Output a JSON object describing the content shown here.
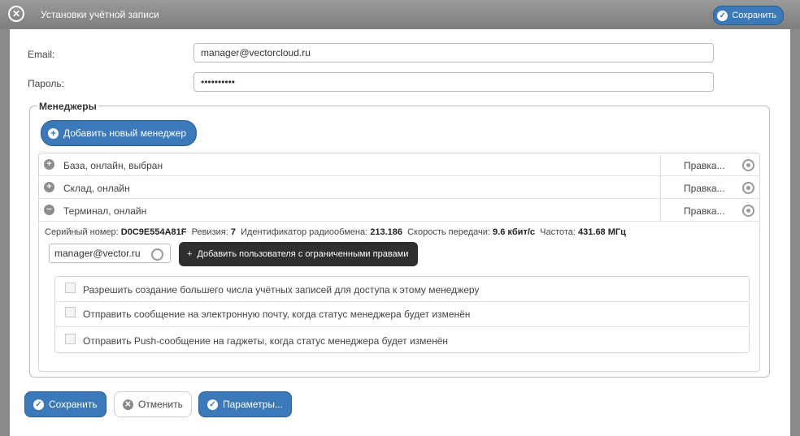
{
  "window": {
    "title": "Установки учётной записи",
    "save_label": "Сохранить"
  },
  "account": {
    "email_label": "Email:",
    "email_value": "manager@vectorcloud.ru",
    "password_label": "Пароль:",
    "password_value": "••••••••••"
  },
  "managers": {
    "legend": "Менеджеры",
    "add_button": "Добавить новый менеджер",
    "rows": [
      {
        "name": "База, онлайн, выбран",
        "action": "Правка...",
        "expanded": false
      },
      {
        "name": "Склад, онлайн",
        "action": "Правка...",
        "expanded": false
      },
      {
        "name": "Терминал, онлайн",
        "action": "Правка...",
        "expanded": true
      }
    ],
    "details": {
      "serial_label": "Серийный номер:",
      "serial_value": "D0C9E554A81F",
      "revision_label": "Ревизия:",
      "revision_value": "7",
      "radio_id_label": "Идентификатор радиообмена:",
      "radio_id_value": "213.186",
      "speed_label": "Скорость передачи:",
      "speed_value": "9.6 кбит/с",
      "freq_label": "Частота:",
      "freq_value": "431.68 МГц"
    },
    "user_input_value": "manager@vector.ru",
    "add_user_button": "Добавить пользователя с ограниченными правами",
    "options": [
      "Разрешить создание большего числа учётных записей для доступа к этому менеджеру",
      "Отправить сообщение на электронную почту, когда статус менеджера будет изменён",
      "Отправить Push-сообщение на гаджеты, когда статус менеджера будет изменён"
    ]
  },
  "footer": {
    "save": "Сохранить",
    "cancel": "Отменить",
    "params": "Параметры..."
  }
}
